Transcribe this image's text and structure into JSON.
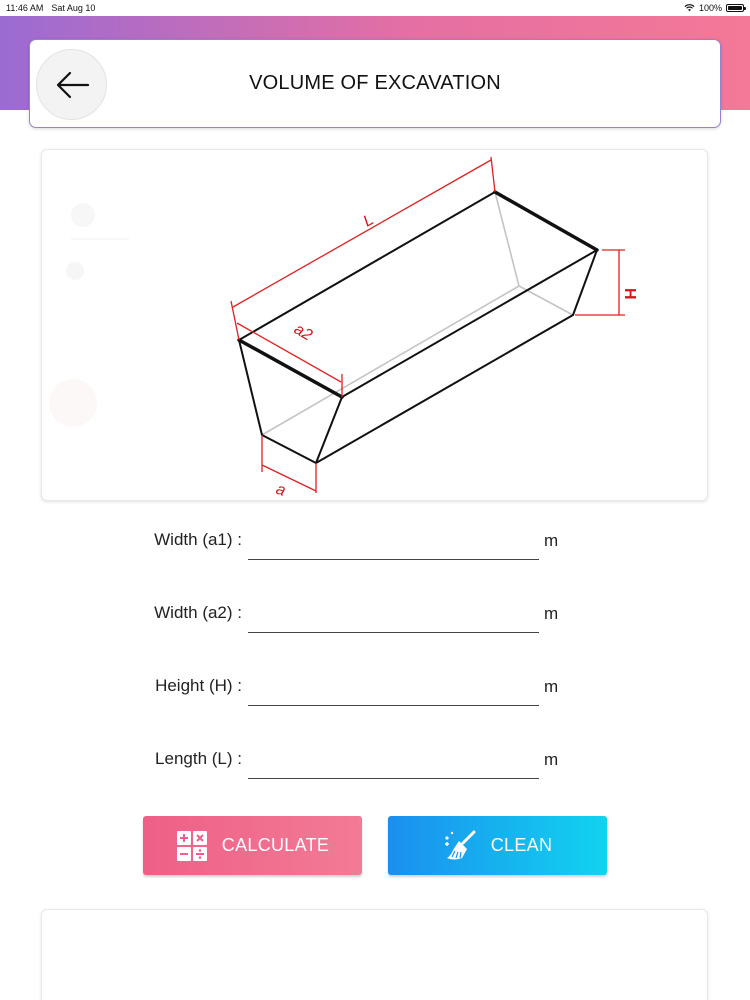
{
  "status_bar": {
    "time": "11:46 AM",
    "date": "Sat Aug 10",
    "battery": "100%"
  },
  "header": {
    "title": "VOLUME OF EXCAVATION",
    "back_icon": "arrow-left-icon"
  },
  "diagram": {
    "label_length": "L",
    "label_top_width": "a2",
    "label_height": "H",
    "label_bottom_width": "a"
  },
  "form": {
    "fields": [
      {
        "label": "Width (a1) :",
        "value": "",
        "unit": "m"
      },
      {
        "label": "Width (a2) :",
        "value": "",
        "unit": "m"
      },
      {
        "label": "Height (H) :",
        "value": "",
        "unit": "m"
      },
      {
        "label": "Length (L) :",
        "value": "",
        "unit": "m"
      }
    ]
  },
  "actions": {
    "calculate_label": "CALCULATE",
    "calculate_icon": "calculator-icon",
    "clean_label": "CLEAN",
    "clean_icon": "broom-icon"
  },
  "colors": {
    "header_gradient_start": "#9b6bd3",
    "header_gradient_end": "#f47897",
    "calculate": "#ef5f87",
    "clean": "#1b8fef",
    "dimension": "#e0201f"
  }
}
